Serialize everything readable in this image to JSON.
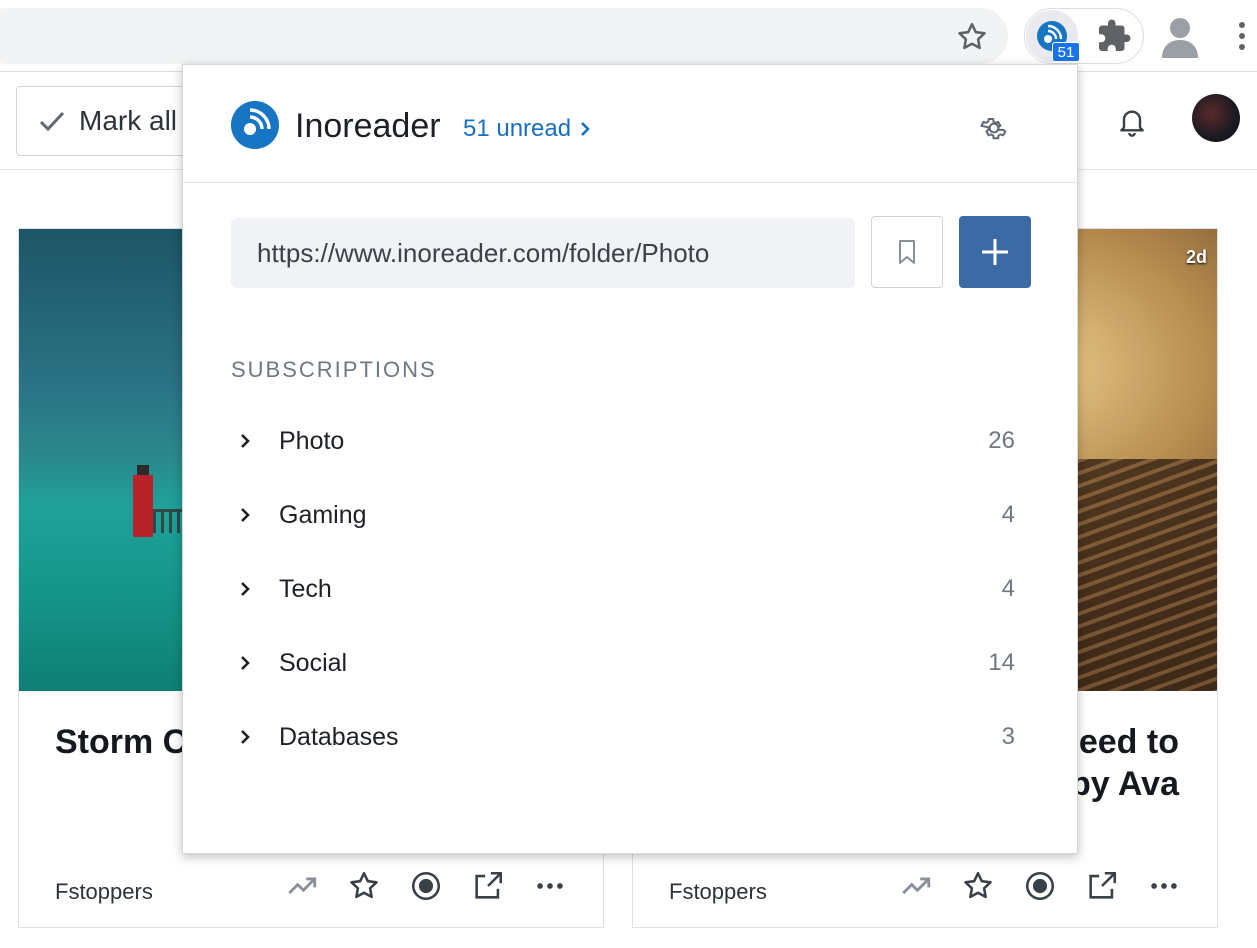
{
  "browser": {
    "extension_badge": "51"
  },
  "page": {
    "mark_all_label": "Mark all",
    "cards": [
      {
        "title": "Storm C",
        "source": "Fstoppers",
        "age": ""
      },
      {
        "title": "Feed to\nby Ava",
        "source": "Fstoppers",
        "age": "2d"
      }
    ]
  },
  "popup": {
    "brand": "Inoreader",
    "unread_link": "51 unread",
    "url_value": "https://www.inoreader.com/folder/Photo",
    "section_title": "SUBSCRIPTIONS",
    "subscriptions": [
      {
        "name": "Photo",
        "count": "26"
      },
      {
        "name": "Gaming",
        "count": "4"
      },
      {
        "name": "Tech",
        "count": "4"
      },
      {
        "name": "Social",
        "count": "14"
      },
      {
        "name": "Databases",
        "count": "3"
      }
    ]
  },
  "colors": {
    "accent": "#1875c4",
    "add_button": "#3c6aa4",
    "link": "#1a6fc0"
  }
}
